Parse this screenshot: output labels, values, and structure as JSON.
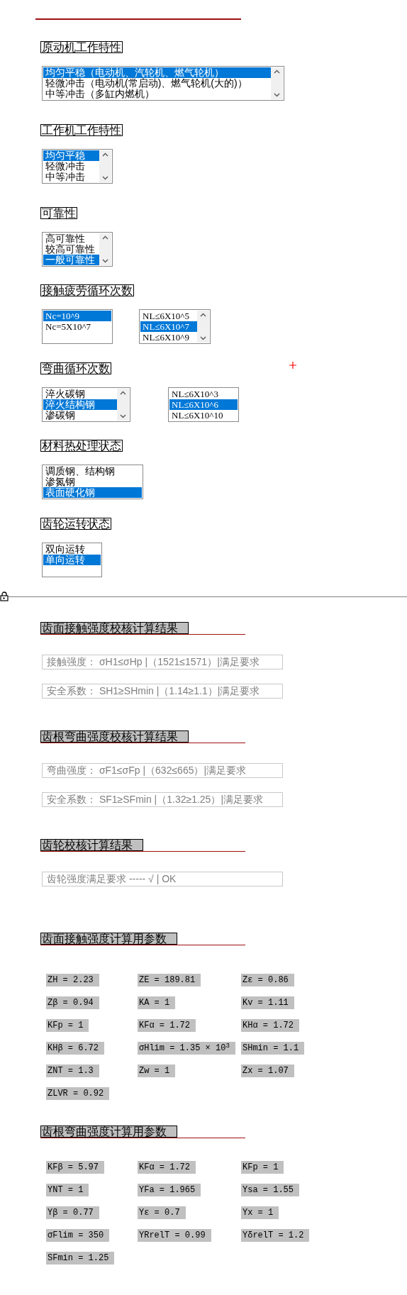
{
  "input_sections": [
    {
      "title": "原动机工作特性",
      "listboxes": [
        {
          "scrollbar": true,
          "items": [
            {
              "label": "均匀平稳（电动机、汽轮机、燃气轮机）",
              "selected": true
            },
            {
              "label": "轻微冲击（电动机(常启动)、燃气轮机(大的)）",
              "selected": false
            },
            {
              "label": "中等冲击（多缸内燃机）",
              "selected": false
            }
          ]
        }
      ]
    },
    {
      "title": "工作机工作特性",
      "listboxes": [
        {
          "scrollbar": true,
          "items": [
            {
              "label": "均匀平稳",
              "selected": true
            },
            {
              "label": "轻微冲击",
              "selected": false
            },
            {
              "label": "中等冲击",
              "selected": false
            }
          ]
        }
      ]
    },
    {
      "title": "可靠性",
      "listboxes": [
        {
          "scrollbar": true,
          "items": [
            {
              "label": "高可靠性",
              "selected": false
            },
            {
              "label": "较高可靠性",
              "selected": false
            },
            {
              "label": "一般可靠性",
              "selected": true
            }
          ]
        }
      ]
    },
    {
      "title": "接触疲劳循环次数",
      "listboxes": [
        {
          "scrollbar": false,
          "items": [
            {
              "label": "Nc=10^9",
              "selected": true
            },
            {
              "label": "Nc=5X10^7",
              "selected": false
            }
          ]
        },
        {
          "scrollbar": true,
          "items": [
            {
              "label": "NL≤6X10^5",
              "selected": false
            },
            {
              "label": "NL≤6X10^7",
              "selected": true
            },
            {
              "label": "NL≤6X10^9",
              "selected": false
            }
          ]
        }
      ]
    },
    {
      "title": "弯曲循环次数",
      "listboxes": [
        {
          "scrollbar": true,
          "items": [
            {
              "label": "淬火碳钢",
              "selected": false
            },
            {
              "label": "淬火结构钢",
              "selected": true
            },
            {
              "label": "渗碳钢",
              "selected": false
            }
          ]
        },
        {
          "scrollbar": false,
          "items": [
            {
              "label": "NL≤6X10^3",
              "selected": false
            },
            {
              "label": "NL≤6X10^6",
              "selected": true
            },
            {
              "label": "NL≤6X10^10",
              "selected": false
            }
          ]
        }
      ]
    },
    {
      "title": "材料热处理状态",
      "listboxes": [
        {
          "scrollbar": false,
          "items": [
            {
              "label": "调质钢、结构钢",
              "selected": false
            },
            {
              "label": "渗氮钢",
              "selected": false
            },
            {
              "label": "表面硬化钢",
              "selected": true
            }
          ]
        }
      ]
    },
    {
      "title": "齿轮运转状态",
      "listboxes": [
        {
          "scrollbar": false,
          "items": [
            {
              "label": "双向运转",
              "selected": false
            },
            {
              "label": "单向运转",
              "selected": true
            }
          ]
        }
      ]
    }
  ],
  "result_sections": [
    {
      "title": "齿面接触强度校核计算结果",
      "fields": [
        "接触强度： σH1≤σHp |（1521≤1571）|满足要求",
        "安全系数： SH1≥SHmin |（1.14≥1.1）|满足要求"
      ]
    },
    {
      "title": "齿根弯曲强度校核计算结果",
      "fields": [
        "弯曲强度： σF1≤σFp |（632≤665）|满足要求",
        "安全系数： SF1≥SFmin |（1.32≥1.25）|满足要求"
      ]
    },
    {
      "title": "齿轮校核计算结果",
      "fields": [
        "齿轮强度满足要求 ----- √ | OK"
      ]
    }
  ],
  "parameter_sections": [
    {
      "title": "齿面接触强度计算用参数",
      "params": [
        "ZH = 2.23",
        "ZE = 189.81",
        "Zε = 0.86",
        "Zβ = 0.94",
        "KA = 1",
        "Kv = 1.11",
        "KFp = 1",
        "KFα = 1.72",
        "KHα = 1.72",
        "KHβ = 6.72",
        "σHlim = 1.35 × 10$^{3}$",
        "SHmin = 1.1",
        "ZNT = 1.3",
        "Zw = 1",
        "Zx = 1.07",
        "ZLVR = 0.92"
      ]
    },
    {
      "title": "齿根弯曲强度计算用参数",
      "params": [
        "KFβ = 5.97",
        "KFα = 1.72",
        "KFp = 1",
        "YNT = 1",
        "YFa = 1.965",
        "Ysa = 1.55",
        "Yβ = 0.77",
        "Yε = 0.7",
        "Yx = 1",
        "σFlim = 350",
        "YRrelT = 0.99",
        "YδrelT = 1.2",
        "SFmin = 1.25"
      ]
    }
  ]
}
